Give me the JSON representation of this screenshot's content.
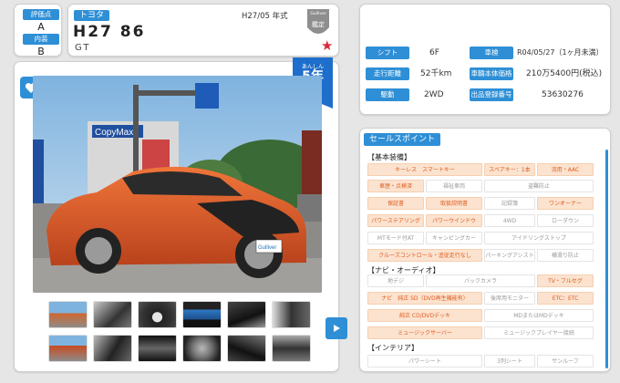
{
  "rating": {
    "score_label": "評価点",
    "score": "A",
    "interior_label": "内装",
    "interior": "B"
  },
  "title": {
    "maker": "トヨタ",
    "model": "H27 86",
    "grade": "GT",
    "year": "H27/05 年式"
  },
  "badge": {
    "brand": "Gulliver",
    "label": "鑑定"
  },
  "ribbon": {
    "line1": "あんしん",
    "line2": "5年",
    "line3": "保証"
  },
  "photo": {
    "sign_text": "CopyMax",
    "plate_text": "Gulliver"
  },
  "specs": [
    {
      "label": "シフト",
      "value": "6F"
    },
    {
      "label": "車検",
      "value": "R04/05/27（1ヶ月未満）"
    },
    {
      "label": "走行距離",
      "value": "52千km"
    },
    {
      "label": "車輌本体価格",
      "value": "210万5400円(税込)"
    },
    {
      "label": "駆動",
      "value": "2WD"
    },
    {
      "label": "出品登録番号",
      "value": "53630276"
    }
  ],
  "sales": {
    "title": "セールスポイント",
    "sections": [
      {
        "name": "【基本装備】"
      },
      {
        "name": "【ナビ・オーディオ】"
      },
      {
        "name": "【インテリア】"
      }
    ],
    "chips": [
      [
        "キーレス　スマートキー",
        "スペアキー：1本",
        "流用・AAC"
      ],
      [
        "車歴・点検済",
        "福祉車両",
        "盗難防止"
      ],
      [
        "保証書",
        "取扱説明書",
        "記録簿",
        "ワンオーナー"
      ],
      [
        "パワーステアリング",
        "パワーウインドウ",
        "4WD",
        "ローダウン"
      ],
      [
        "MTモード付AT",
        "キャンピングカー",
        "アイドリングストップ"
      ],
      [
        "クルーズコントロール・追従走行なし",
        "パーキングアシスト",
        "横滑り防止"
      ],
      [
        "地デジ",
        "バックカメラ",
        "TV・フルセグ"
      ],
      [
        "ナビ　純正 SD（DVD再生機能有）",
        "後席用モニター",
        "ETC：ETC"
      ],
      [
        "純正 CD/DVDデッキ",
        "MDまたはMDデッキ"
      ],
      [
        "ミュージックサーバー",
        "ミュージックプレイヤー接続"
      ],
      [
        "パワーシート",
        "3列シート",
        "サンルーフ"
      ]
    ]
  }
}
